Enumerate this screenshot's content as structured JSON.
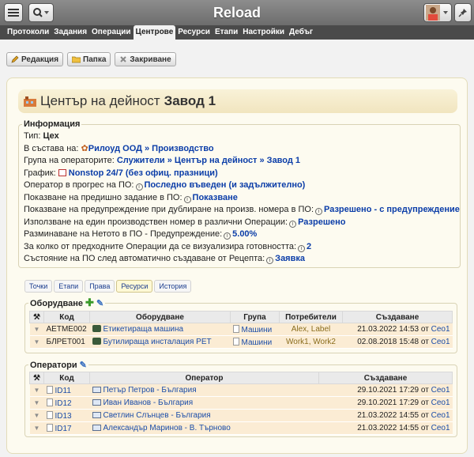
{
  "app": {
    "title": "Reload"
  },
  "nav": [
    "Протоколи",
    "Задания",
    "Операции",
    "Центрове",
    "Ресурси",
    "Етапи",
    "Настройки",
    "Дебъг"
  ],
  "toolbar": {
    "edit": "Редакция",
    "folder": "Папка",
    "close": "Закриване"
  },
  "heading": {
    "prefix": "Център на дейност",
    "name": "Завод 1"
  },
  "info": {
    "legend": "Информация",
    "type_label": "Тип:",
    "type_value": "Цех",
    "part_label": "В състава на:",
    "part_value": "Рилоуд ООД » Производство",
    "group_label": "Група на операторите:",
    "group_value": "Служители » Център на дейност » Завод 1",
    "schedule_label": "График:",
    "schedule_value": "Nonstop 24/7 (без офиц. празници)",
    "operator_label": "Оператор в прогрес на ПО:",
    "operator_value": "Последно въведен (и задължително)",
    "prev_label": "Показване на предишно задание в ПО:",
    "prev_value": "Показване",
    "dup_label": "Показване на предупреждение при дублиране на произв. номера в ПО:",
    "dup_value": "Разрешено - с предупреждение",
    "same_label": "Използване на един производствен номер в различни Операции:",
    "same_value": "Разрешено",
    "diff_label": "Разминаване на Нетото в ПО - Предупреждение:",
    "diff_value": "5.00%",
    "count_label": "За колко от предходните Операции да се визуализира готовността:",
    "count_value": "2",
    "state_label": "Състояние на ПО след автоматично създаване от Рецепта:",
    "state_value": "Заявка"
  },
  "tabs": [
    "Точки",
    "Етапи",
    "Права",
    "Ресурси",
    "История"
  ],
  "equipment": {
    "legend": "Оборудване",
    "headers": [
      "Код",
      "Оборудване",
      "Група",
      "Потребители",
      "Създаване"
    ],
    "rows": [
      {
        "code": "AETME002",
        "name": "Етикетираща машина",
        "group": "Машини",
        "users": "Alex, Label",
        "date": "21.03.2022 14:53 от",
        "by": "Ceo1"
      },
      {
        "code": "БЛРЕТ001",
        "name": "Бутилираща инсталация PET",
        "group": "Машини",
        "users": "Work1, Work2",
        "date": "02.08.2018 15:48 от",
        "by": "Ceo1"
      }
    ]
  },
  "operators": {
    "legend": "Оператори",
    "headers": [
      "Код",
      "Оператор",
      "Създаване"
    ],
    "rows": [
      {
        "code": "ID11",
        "name": "Петър Петров - България",
        "date": "29.10.2021 17:29 от",
        "by": "Ceo1"
      },
      {
        "code": "ID12",
        "name": "Иван Иванов - България",
        "date": "29.10.2021 17:29 от",
        "by": "Ceo1"
      },
      {
        "code": "ID13",
        "name": "Светлин Слънцев - България",
        "date": "21.03.2022 14:55 от",
        "by": "Ceo1"
      },
      {
        "code": "ID17",
        "name": "Александър Маринов - В. Търново",
        "date": "21.03.2022 14:55 от",
        "by": "Ceo1"
      }
    ]
  }
}
